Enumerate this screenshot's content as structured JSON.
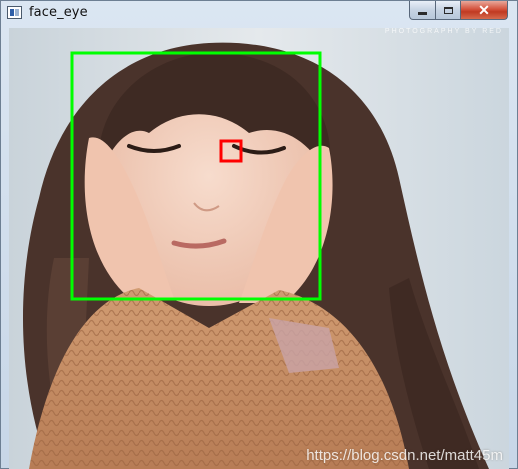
{
  "window": {
    "title": "face_eye",
    "controls": {
      "minimize": "minimize",
      "maximize": "maximize",
      "close": "✕"
    }
  },
  "image": {
    "photo_credit": "PHOTOGRAPHY BY RED",
    "watermark": "https://blog.csdn.net/matt45m"
  },
  "detections": {
    "face_color": "#00ff00",
    "eye_color": "#ff0000"
  },
  "colors": {
    "titlebar": "#c7d6e7",
    "close_button": "#c03a22"
  }
}
